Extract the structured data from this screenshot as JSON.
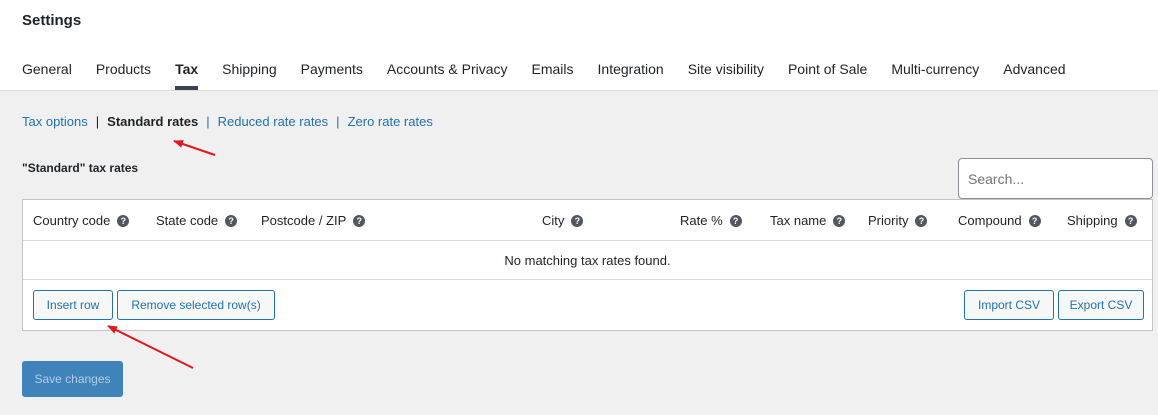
{
  "page_title": "Settings",
  "tabs": [
    {
      "label": "General"
    },
    {
      "label": "Products"
    },
    {
      "label": "Tax",
      "active": true
    },
    {
      "label": "Shipping"
    },
    {
      "label": "Payments"
    },
    {
      "label": "Accounts & Privacy"
    },
    {
      "label": "Emails"
    },
    {
      "label": "Integration"
    },
    {
      "label": "Site visibility"
    },
    {
      "label": "Point of Sale"
    },
    {
      "label": "Multi-currency"
    },
    {
      "label": "Advanced"
    }
  ],
  "subsections": {
    "tax_options": "Tax options",
    "standard_rates": "Standard rates",
    "reduced_rate_rates": "Reduced rate rates",
    "zero_rate_rates": "Zero rate rates",
    "separator": "|"
  },
  "rates_heading": "\"Standard\" tax rates",
  "search": {
    "placeholder": "Search..."
  },
  "table": {
    "columns": {
      "country_code": "Country code",
      "state_code": "State code",
      "postcode": "Postcode / ZIP",
      "city": "City",
      "rate": "Rate %",
      "tax_name": "Tax name",
      "priority": "Priority",
      "compound": "Compound",
      "shipping": "Shipping"
    },
    "help_glyph": "?",
    "empty_message": "No matching tax rates found.",
    "buttons": {
      "insert_row": "Insert row",
      "remove_selected": "Remove selected row(s)",
      "import_csv": "Import CSV",
      "export_csv": "Export CSV"
    }
  },
  "save_button": "Save changes",
  "colors": {
    "accent": "#2271b1",
    "annotation_arrow": "#e0191f"
  }
}
